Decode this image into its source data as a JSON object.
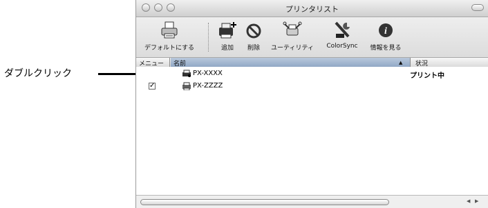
{
  "annotation": {
    "callout_text": "ダブルクリック"
  },
  "window": {
    "title": "プリンタリスト"
  },
  "toolbar": {
    "items": [
      {
        "label": "デフォルトにする",
        "icon": "printer-default-icon"
      },
      {
        "label": "追加",
        "icon": "add-printer-icon"
      },
      {
        "label": "削除",
        "icon": "delete-icon"
      },
      {
        "label": "ユーティリティ",
        "icon": "utility-icon"
      },
      {
        "label": "ColorSync",
        "icon": "colorsync-icon"
      },
      {
        "label": "情報を見る",
        "icon": "info-icon"
      }
    ]
  },
  "columns": {
    "menu": "メニュー",
    "name": "名前",
    "status": "状況",
    "sort_indicator": "▲"
  },
  "printers": [
    {
      "name": "PX-XXXX",
      "status": "プリント中",
      "in_menu": false,
      "icon": "printer-active-icon"
    },
    {
      "name": "PX-ZZZZ",
      "status": "",
      "in_menu": true,
      "check": "✓",
      "icon": "printer-icon"
    }
  ],
  "scrollbar": {
    "left_arrow": "◀",
    "right_arrow": "▶"
  }
}
